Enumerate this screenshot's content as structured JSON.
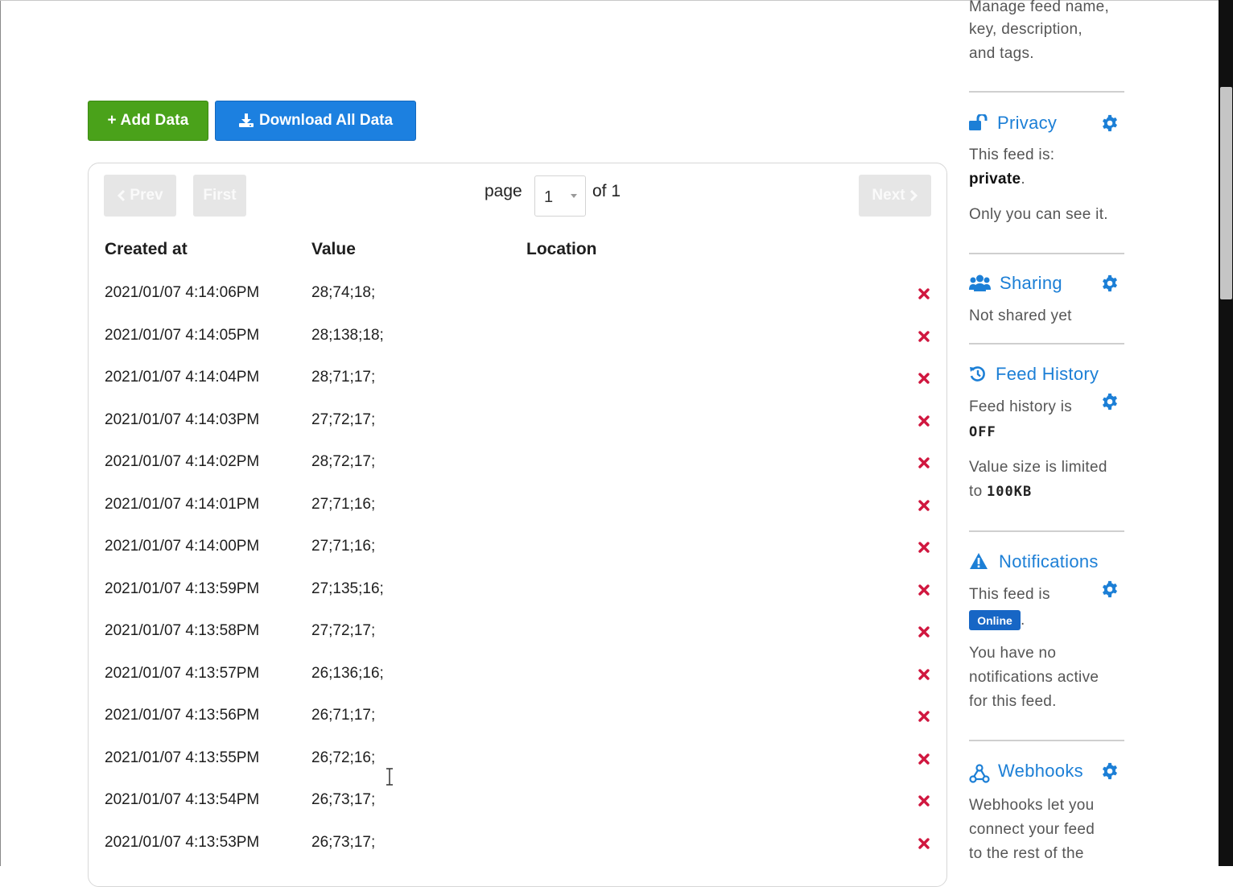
{
  "toolbar": {
    "add_label": "+ Add Data",
    "download_label": "Download All Data"
  },
  "pager": {
    "prev_label": "Prev",
    "first_label": "First",
    "next_label": "Next",
    "page_label": "page",
    "current_page": "1",
    "of_label": "of 1"
  },
  "table": {
    "headers": {
      "created": "Created at",
      "value": "Value",
      "location": "Location"
    },
    "rows": [
      {
        "created": "2021/01/07 4:14:06PM",
        "value": "28;74;18;"
      },
      {
        "created": "2021/01/07 4:14:05PM",
        "value": "28;138;18;"
      },
      {
        "created": "2021/01/07 4:14:04PM",
        "value": "28;71;17;"
      },
      {
        "created": "2021/01/07 4:14:03PM",
        "value": "27;72;17;"
      },
      {
        "created": "2021/01/07 4:14:02PM",
        "value": "28;72;17;"
      },
      {
        "created": "2021/01/07 4:14:01PM",
        "value": "27;71;16;"
      },
      {
        "created": "2021/01/07 4:14:00PM",
        "value": "27;71;16;"
      },
      {
        "created": "2021/01/07 4:13:59PM",
        "value": "27;135;16;"
      },
      {
        "created": "2021/01/07 4:13:58PM",
        "value": "27;72;17;"
      },
      {
        "created": "2021/01/07 4:13:57PM",
        "value": "26;136;16;"
      },
      {
        "created": "2021/01/07 4:13:56PM",
        "value": "26;71;17;"
      },
      {
        "created": "2021/01/07 4:13:55PM",
        "value": "26;72;16;"
      },
      {
        "created": "2021/01/07 4:13:54PM",
        "value": "26;73;17;"
      },
      {
        "created": "2021/01/07 4:13:53PM",
        "value": "26;73;17;"
      }
    ]
  },
  "sidebar": {
    "manage_line1": "Manage feed name,",
    "manage_line2": "key, description,",
    "manage_line3": "and tags.",
    "privacy": {
      "title": "Privacy",
      "line1": "This feed is:",
      "status": "private",
      "status_suffix": ".",
      "line2": "Only you can see it."
    },
    "sharing": {
      "title": "Sharing",
      "line1": "Not shared yet"
    },
    "history": {
      "title": "Feed History",
      "line1": "Feed history is",
      "status": "OFF",
      "line2": "Value size is limited",
      "line3_prefix": "to",
      "size": "100KB"
    },
    "notifications": {
      "title": "Notifications",
      "line1": "This feed is",
      "badge": "Online",
      "badge_suffix": ".",
      "line2": "You have no",
      "line3": "notifications active",
      "line4": "for this feed."
    },
    "webhooks": {
      "title": "Webhooks",
      "line1": "Webhooks let you",
      "line2": "connect your feed",
      "line3": "to the rest of the"
    }
  },
  "colors": {
    "add_green": "#4aa21a",
    "download_blue": "#1c80e0",
    "link_blue": "#1c7fd6",
    "delete_red": "#d0173f",
    "badge_blue": "#1766c5"
  },
  "icons": {
    "download": "download-icon",
    "delete": "delete-x-icon",
    "privacy": "unlock-icon",
    "sharing": "users-icon",
    "history": "history-icon",
    "notifications": "warning-icon",
    "webhooks": "webhook-icon",
    "settings": "gear-icon"
  }
}
